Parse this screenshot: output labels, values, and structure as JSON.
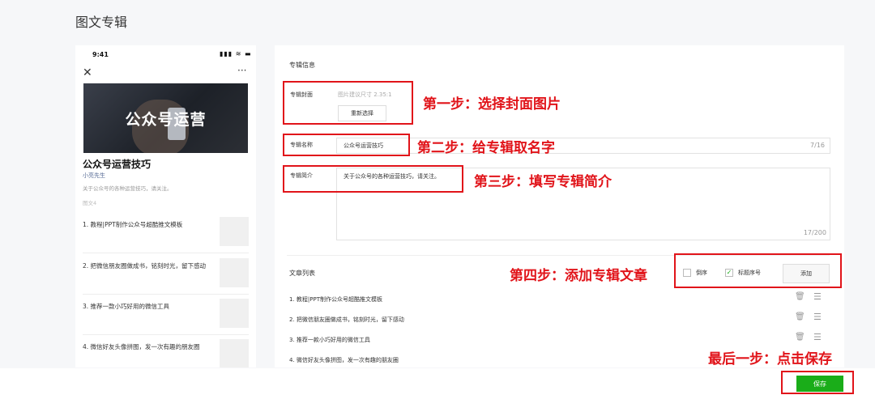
{
  "page": {
    "title": "图文专辑"
  },
  "phone": {
    "time": "9:41",
    "status": "▮▮▮ ≋ ▬",
    "close": "✕",
    "more": "···",
    "cover_text": "公众号运营",
    "album_name": "公众号运营技巧",
    "author": "小亮先生",
    "description": "关于公众号的各种运营技巧，请关注。",
    "count_label": "图文4",
    "items": [
      {
        "text": "1. 教程|PPT制作公众号超酷推文模板"
      },
      {
        "text": "2. 把微信朋友圈做成书，铭刻时光，留下感动"
      },
      {
        "text": "3. 推荐一款小巧好用的微信工具"
      },
      {
        "text": "4. 微信好友头像拼图，发一次有趣的朋友圈"
      }
    ]
  },
  "panel": {
    "section_title": "专辑信息",
    "cover_label": "专辑封面",
    "cover_tip": "图片建议尺寸 2.35:1",
    "reselect_label": "重新选择",
    "name_label": "专辑名称",
    "name_value": "公众号运营技巧",
    "name_count": "7/16",
    "intro_label": "专辑简介",
    "intro_value": "关于公众号的各种运营技巧，请关注。",
    "intro_count": "17/200",
    "list_title": "文章列表",
    "reverse_label": "倒序",
    "reverse_checked": false,
    "serial_label": "标题序号",
    "serial_checked": true,
    "add_label": "添加",
    "articles": [
      {
        "text": "1. 教程|PPT制作公众号超酷推文模板"
      },
      {
        "text": "2. 把微信朋友圈做成书，铭刻时光，留下感动"
      },
      {
        "text": "3. 推荐一款小巧好用的微信工具"
      },
      {
        "text": "4. 微信好友头像拼图，发一次有趣的朋友圈"
      }
    ]
  },
  "footer": {
    "save_label": "保存"
  },
  "annotations": {
    "step1": "第一步：选择封面图片",
    "step2": "第二步：给专辑取名字",
    "step3": "第三步：填写专辑简介",
    "step4": "第四步：添加专辑文章",
    "final": "最后一步：点击保存"
  },
  "colors": {
    "accent_green": "#1aad19",
    "annotation_red": "#e1141a",
    "link_blue": "#576b95"
  },
  "icons": {
    "delete": "trash-icon",
    "sort": "drag-handle-icon"
  }
}
